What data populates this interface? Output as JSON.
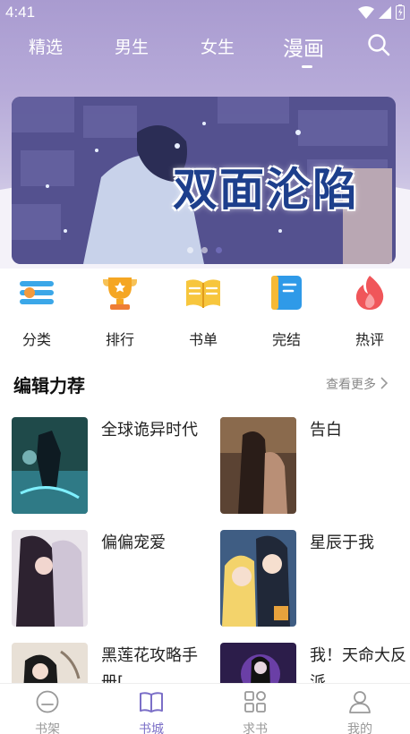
{
  "status": {
    "time": "4:41"
  },
  "nav": {
    "tabs": [
      "精选",
      "男生",
      "女生",
      "漫画"
    ],
    "active_tab": "漫画"
  },
  "banner": {
    "title": "双面沦陷"
  },
  "categories": [
    {
      "label": "分类",
      "icon": "category-icon"
    },
    {
      "label": "排行",
      "icon": "trophy-icon"
    },
    {
      "label": "书单",
      "icon": "open-book-icon"
    },
    {
      "label": "完结",
      "icon": "finished-book-icon"
    },
    {
      "label": "热评",
      "icon": "flame-icon"
    }
  ],
  "section": {
    "title": "编辑力荐",
    "more": "查看更多"
  },
  "books": [
    {
      "title": "全球诡异时代"
    },
    {
      "title": "告白"
    },
    {
      "title": "偏偏宠爱"
    },
    {
      "title": "星辰于我"
    },
    {
      "title": "黑莲花攻略手册["
    },
    {
      "title": "我！天命大反派"
    }
  ],
  "bottom_nav": [
    {
      "label": "书架",
      "icon": "bookshelf-icon"
    },
    {
      "label": "书城",
      "icon": "bookstore-icon"
    },
    {
      "label": "求书",
      "icon": "grid-icon"
    },
    {
      "label": "我的",
      "icon": "user-icon"
    }
  ],
  "colors": {
    "accent": "#7b6fc7",
    "header": "#a99bd0"
  }
}
